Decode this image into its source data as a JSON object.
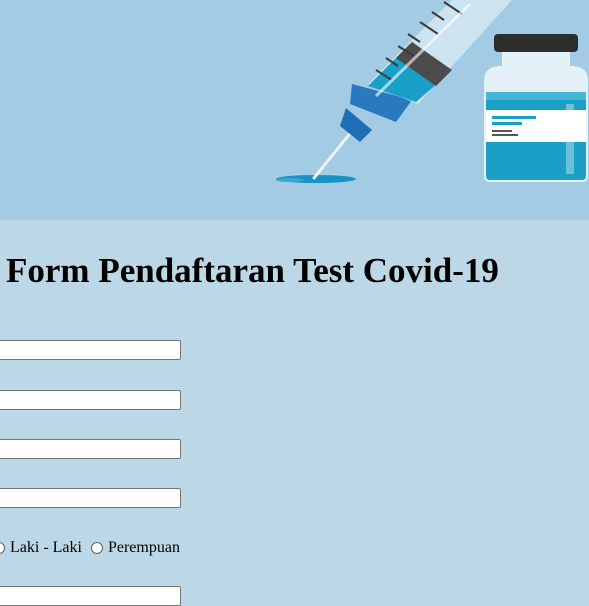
{
  "page": {
    "title": "Form Pendaftaran Test Covid-19"
  },
  "banner": {
    "illustration": "syringe-and-vaccine-vial",
    "background_color": "#a4cbe4"
  },
  "form": {
    "fields": [
      {
        "name": "field-1",
        "value": "",
        "placeholder": ""
      },
      {
        "name": "field-2",
        "value": "",
        "placeholder": ""
      },
      {
        "name": "field-3",
        "value": "",
        "placeholder": ""
      },
      {
        "name": "field-4",
        "value": "",
        "placeholder": ""
      },
      {
        "name": "field-6",
        "value": "",
        "placeholder": ""
      }
    ],
    "gender": {
      "options": [
        {
          "label": "Laki - Laki",
          "selected": false
        },
        {
          "label": "Perempuan",
          "selected": false
        }
      ]
    }
  },
  "colors": {
    "page_background": "#bcd8e6",
    "liquid": "#1aa0c6",
    "needle_cap": "#1e6fb3"
  }
}
